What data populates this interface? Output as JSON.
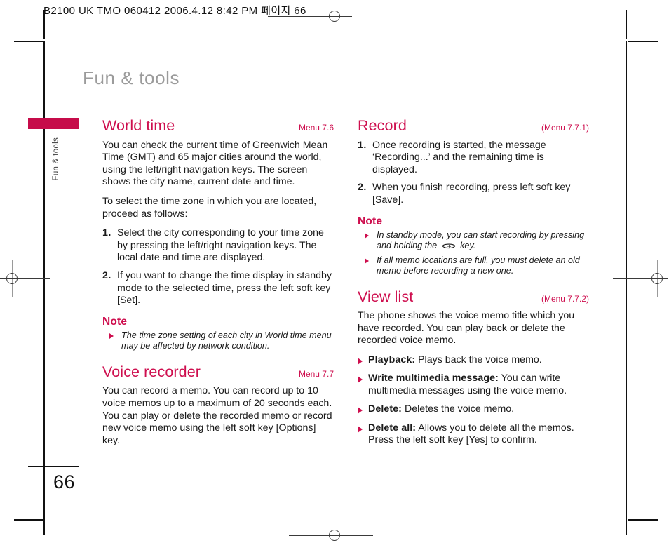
{
  "prepress": {
    "header_text": "B2100 UK TMO 060412  2006.4.12 8:42 PM  페이지 66",
    "reg_mark_name": "registration-mark"
  },
  "page": {
    "running_head": "Fun & tools",
    "tab_label": "Fun & tools",
    "folio": "66",
    "accent_color": "#ce0e4e",
    "tab_color": "#c60c4a"
  },
  "left_column": {
    "sections": [
      {
        "title": "World time",
        "menu": "Menu 7.6",
        "paragraphs": [
          "You can check the current time of Greenwich Mean Time (GMT) and 65 major cities around the world, using the left/right navigation keys. The screen shows the city name, current date and time.",
          "To select the time zone in which you are located, proceed as follows:"
        ],
        "steps": [
          {
            "num": "1.",
            "text": "Select the city corresponding to your time zone by pressing the left/right navigation keys. The local date and time are displayed."
          },
          {
            "num": "2.",
            "text": "If you want to change the time display in standby mode to the selected time, press the left soft key [Set]."
          }
        ],
        "note_heading": "Note",
        "notes": [
          "The time zone setting of each city in World time menu may be affected by network condition."
        ]
      },
      {
        "title": "Voice recorder",
        "menu": "Menu 7.7",
        "paragraphs": [
          "You can record a memo. You can record up to 10 voice memos up to a maximum of 20 seconds each. You can play or delete the recorded memo or record new voice memo using the left soft key [Options] key."
        ]
      }
    ]
  },
  "right_column": {
    "sections": [
      {
        "title": "Record",
        "menu": "(Menu 7.7.1)",
        "steps": [
          {
            "num": "1.",
            "text": "Once recording is started, the message ‘Recording...’ and the remaining time is displayed."
          },
          {
            "num": "2.",
            "text": "When you finish recording, press left soft key [Save]."
          }
        ],
        "note_heading": "Note",
        "notes": [
          {
            "before": "In standby mode, you can start recording by pressing and holding the ",
            "icon": "clear-key-icon",
            "after": " key."
          },
          {
            "before": "If all memo locations are full, you must delete an old memo before recording a new one.",
            "icon": null,
            "after": ""
          }
        ]
      },
      {
        "title": "View list",
        "menu": "(Menu 7.7.2)",
        "paragraphs": [
          "The phone shows the voice memo title which you have recorded. You can play back or delete the recorded voice memo."
        ],
        "items": [
          {
            "term": "Playback:",
            "desc": " Plays back the voice memo."
          },
          {
            "term": "Write multimedia message:",
            "desc": " You can write multimedia messages using the voice memo."
          },
          {
            "term": "Delete:",
            "desc": " Deletes the voice memo."
          },
          {
            "term": "Delete all:",
            "desc": " Allows you to delete all the memos. Press the left soft key [Yes] to confirm."
          }
        ]
      }
    ]
  }
}
